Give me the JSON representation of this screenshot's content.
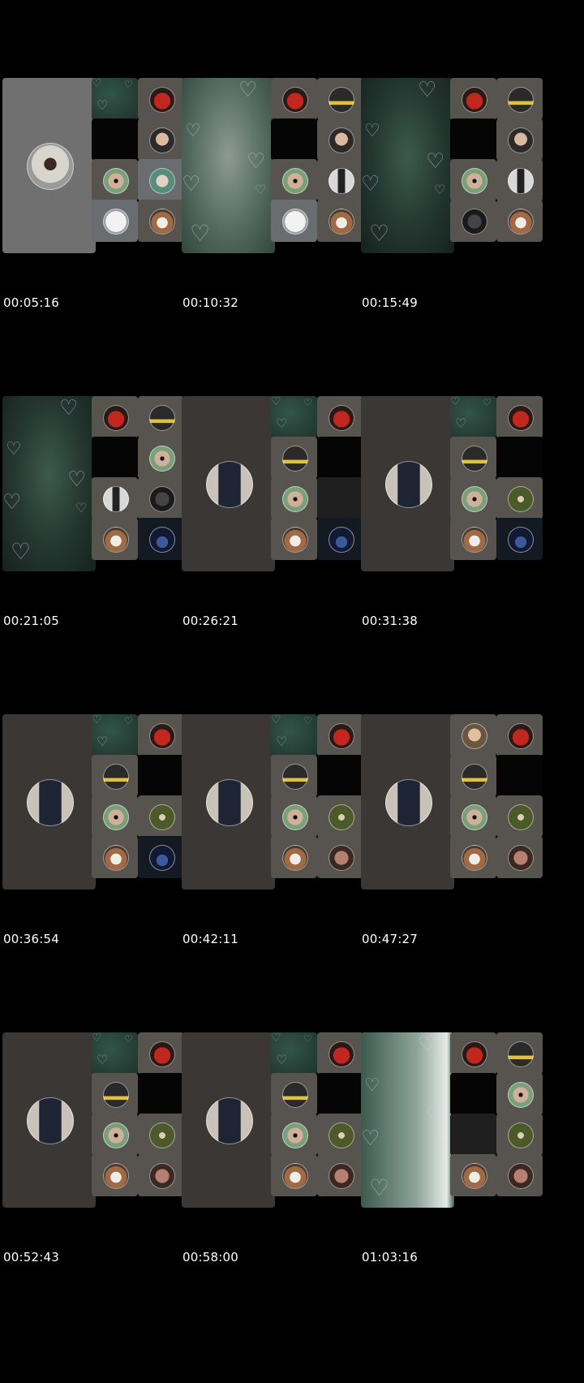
{
  "frames": [
    {
      "timestamp": "00:05:16",
      "main": "gray",
      "main_avatar": "man-white-suit",
      "tiles": [
        "teal-hearts",
        "red-avatar",
        "black",
        "selfie-avatar",
        "sunglasses-avatar",
        "pool-avatar",
        "white-ball-avatar",
        "hat-avatar"
      ]
    },
    {
      "timestamp": "00:10:32",
      "main": "bright-hearts",
      "main_avatar": "",
      "tiles": [
        "red-avatar",
        "badge-avatar",
        "black",
        "selfie-avatar",
        "sunglasses-avatar",
        "standing-avatar",
        "white-ball-avatar",
        "hat-avatar"
      ]
    },
    {
      "timestamp": "00:15:49",
      "main": "teal-hearts",
      "main_avatar": "",
      "tiles": [
        "red-avatar",
        "badge-avatar",
        "black",
        "selfie-avatar",
        "sunglasses-avatar",
        "standing-avatar",
        "dark-avatar",
        "hat-avatar"
      ]
    },
    {
      "timestamp": "00:21:05",
      "main": "teal-hearts",
      "main_avatar": "",
      "tiles": [
        "red-avatar",
        "badge-avatar",
        "black",
        "sunglasses-avatar",
        "standing-avatar",
        "dark-avatar",
        "hat-avatar",
        "city-avatar"
      ]
    },
    {
      "timestamp": "00:26:21",
      "main": "dark",
      "main_avatar": "man-dark-suit",
      "tiles": [
        "teal-hearts",
        "red-avatar",
        "badge-avatar",
        "black",
        "sunglasses-avatar",
        "empty",
        "hat-avatar",
        "city-avatar"
      ]
    },
    {
      "timestamp": "00:31:38",
      "main": "dark",
      "main_avatar": "man-dark-suit",
      "tiles": [
        "teal-hearts",
        "red-avatar",
        "badge-avatar",
        "black",
        "sunglasses-avatar",
        "palm-avatar",
        "hat-avatar",
        "city-avatar"
      ]
    },
    {
      "timestamp": "00:36:54",
      "main": "dark",
      "main_avatar": "man-dark-suit",
      "tiles": [
        "teal-hearts",
        "red-avatar",
        "badge-avatar",
        "black",
        "sunglasses-avatar",
        "palm-avatar",
        "hat-avatar",
        "city-avatar"
      ]
    },
    {
      "timestamp": "00:42:11",
      "main": "dark",
      "main_avatar": "man-dark-suit",
      "tiles": [
        "teal-hearts",
        "red-avatar",
        "badge-avatar",
        "black",
        "sunglasses-avatar",
        "palm-avatar",
        "hat-avatar",
        "rose-avatar"
      ]
    },
    {
      "timestamp": "00:47:27",
      "main": "dark",
      "main_avatar": "man-dark-suit",
      "tiles": [
        "bearded-avatar",
        "red-avatar",
        "badge-avatar",
        "black",
        "sunglasses-avatar",
        "palm-avatar",
        "hat-avatar",
        "rose-avatar"
      ]
    },
    {
      "timestamp": "00:52:43",
      "main": "dark",
      "main_avatar": "man-dark-suit",
      "tiles": [
        "teal-hearts",
        "red-avatar",
        "badge-avatar",
        "black",
        "sunglasses-avatar",
        "palm-avatar",
        "hat-avatar",
        "rose-avatar"
      ]
    },
    {
      "timestamp": "00:58:00",
      "main": "dark",
      "main_avatar": "man-dark-suit",
      "tiles": [
        "teal-hearts",
        "red-avatar",
        "badge-avatar",
        "black",
        "sunglasses-avatar",
        "palm-avatar",
        "hat-avatar",
        "rose-avatar"
      ]
    },
    {
      "timestamp": "01:03:16",
      "main": "white-hearts",
      "main_avatar": "",
      "tiles": [
        "red-avatar",
        "badge-avatar",
        "black",
        "sunglasses-avatar",
        "empty",
        "palm-avatar",
        "hat-avatar",
        "rose-avatar"
      ]
    }
  ],
  "colors": {
    "background": "#000000",
    "timestamp": "#ffffff"
  }
}
